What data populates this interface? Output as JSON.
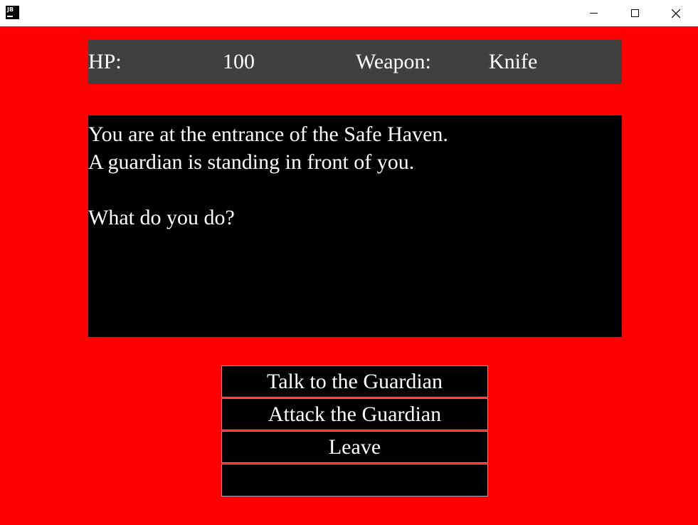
{
  "titlebar": {
    "app_icon_text": "JB",
    "buttons": {
      "minimize": "minimize-icon",
      "maximize": "maximize-icon",
      "close": "close-icon"
    }
  },
  "colors": {
    "background": "#ff0000",
    "status_panel": "#404040",
    "text_panel": "#000000",
    "text": "#ffffff",
    "button_border": "#9aa5b5"
  },
  "status": {
    "hp_label": "HP:",
    "hp_value": "100",
    "weapon_label": "Weapon:",
    "weapon_value": "Knife"
  },
  "main_text": {
    "lines": [
      "You are at the entrance of the Safe Haven.",
      "A guardian is standing in front of you.",
      "",
      "What do you do?"
    ]
  },
  "choices": [
    "Talk to the Guardian",
    "Attack the Guardian",
    "Leave",
    ""
  ]
}
